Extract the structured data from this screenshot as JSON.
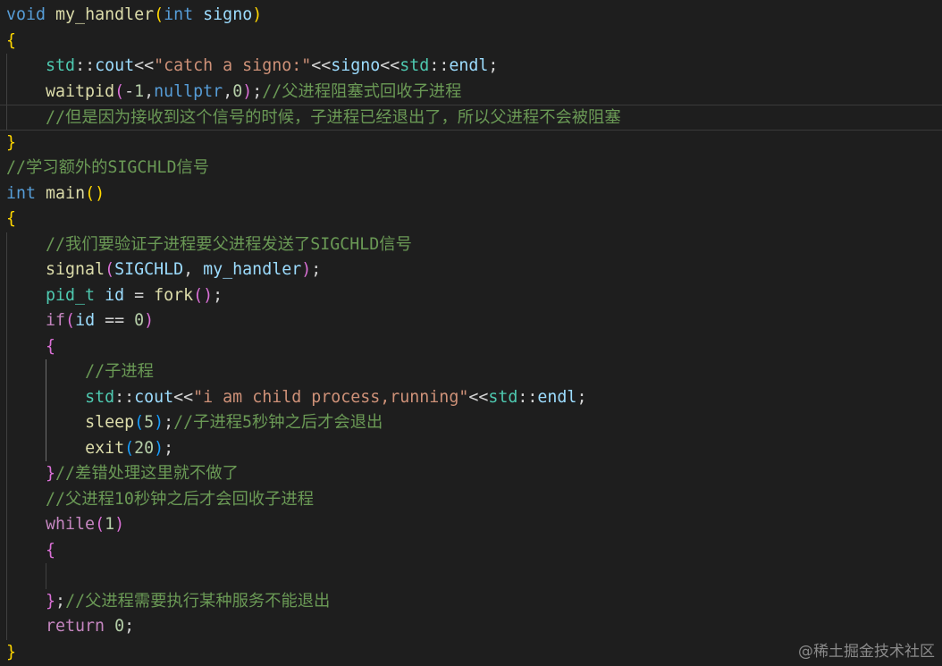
{
  "editor": {
    "theme_colors": {
      "background": "#1e1e1e",
      "keyword": "#569cd6",
      "control": "#c586c0",
      "function": "#dcdcaa",
      "variable": "#9cdcfe",
      "string": "#ce9178",
      "number": "#b5cea8",
      "comment": "#6a9955"
    },
    "lines": [
      [
        [
          "kw",
          "void"
        ],
        [
          "plain",
          " "
        ],
        [
          "fn",
          "my_handler"
        ],
        [
          "br1",
          "("
        ],
        [
          "kw",
          "int"
        ],
        [
          "plain",
          " "
        ],
        [
          "var",
          "signo"
        ],
        [
          "br1",
          ")"
        ]
      ],
      [
        [
          "br1",
          "{"
        ]
      ],
      [
        [
          "plain",
          "    "
        ],
        [
          "ty",
          "std"
        ],
        [
          "plain",
          "::"
        ],
        [
          "var",
          "cout"
        ],
        [
          "plain",
          "<<"
        ],
        [
          "str",
          "\"catch a signo:\""
        ],
        [
          "plain",
          "<<"
        ],
        [
          "var",
          "signo"
        ],
        [
          "plain",
          "<<"
        ],
        [
          "ty",
          "std"
        ],
        [
          "plain",
          "::"
        ],
        [
          "var",
          "endl"
        ],
        [
          "plain",
          ";"
        ]
      ],
      [
        [
          "plain",
          "    "
        ],
        [
          "fn",
          "waitpid"
        ],
        [
          "br2",
          "("
        ],
        [
          "plain",
          "-"
        ],
        [
          "num",
          "1"
        ],
        [
          "plain",
          ","
        ],
        [
          "kw",
          "nullptr"
        ],
        [
          "plain",
          ","
        ],
        [
          "num",
          "0"
        ],
        [
          "br2",
          ")"
        ],
        [
          "plain",
          ";"
        ],
        [
          "cmt",
          "//父进程阻塞式回收子进程"
        ]
      ],
      [
        [
          "plain",
          "    "
        ],
        [
          "cmt",
          "//但是因为接收到这个信号的时候，子进程已经退出了，所以父进程不会被阻塞"
        ]
      ],
      [
        [
          "br1",
          "}"
        ]
      ],
      [
        [
          "cmt",
          "//学习额外的SIGCHLD信号"
        ]
      ],
      [
        [
          "kw",
          "int"
        ],
        [
          "plain",
          " "
        ],
        [
          "fn",
          "main"
        ],
        [
          "br1",
          "()"
        ]
      ],
      [
        [
          "br1",
          "{"
        ]
      ],
      [
        [
          "plain",
          "    "
        ],
        [
          "cmt",
          "//我们要验证子进程要父进程发送了SIGCHLD信号"
        ]
      ],
      [
        [
          "plain",
          "    "
        ],
        [
          "fn",
          "signal"
        ],
        [
          "br2",
          "("
        ],
        [
          "var",
          "SIGCHLD"
        ],
        [
          "plain",
          ", "
        ],
        [
          "var",
          "my_handler"
        ],
        [
          "br2",
          ")"
        ],
        [
          "plain",
          ";"
        ]
      ],
      [
        [
          "plain",
          "    "
        ],
        [
          "ty",
          "pid_t"
        ],
        [
          "plain",
          " "
        ],
        [
          "var",
          "id"
        ],
        [
          "plain",
          " = "
        ],
        [
          "fn",
          "fork"
        ],
        [
          "br2",
          "()"
        ],
        [
          "plain",
          ";"
        ]
      ],
      [
        [
          "plain",
          "    "
        ],
        [
          "ctl",
          "if"
        ],
        [
          "br2",
          "("
        ],
        [
          "var",
          "id"
        ],
        [
          "plain",
          " == "
        ],
        [
          "num",
          "0"
        ],
        [
          "br2",
          ")"
        ]
      ],
      [
        [
          "plain",
          "    "
        ],
        [
          "br2",
          "{"
        ]
      ],
      [
        [
          "plain",
          "        "
        ],
        [
          "cmt",
          "//子进程"
        ]
      ],
      [
        [
          "plain",
          "        "
        ],
        [
          "ty",
          "std"
        ],
        [
          "plain",
          "::"
        ],
        [
          "var",
          "cout"
        ],
        [
          "plain",
          "<<"
        ],
        [
          "str",
          "\"i am child process,running\""
        ],
        [
          "plain",
          "<<"
        ],
        [
          "ty",
          "std"
        ],
        [
          "plain",
          "::"
        ],
        [
          "var",
          "endl"
        ],
        [
          "plain",
          ";"
        ]
      ],
      [
        [
          "plain",
          "        "
        ],
        [
          "fn",
          "sleep"
        ],
        [
          "br3",
          "("
        ],
        [
          "num",
          "5"
        ],
        [
          "br3",
          ")"
        ],
        [
          "plain",
          ";"
        ],
        [
          "cmt",
          "//子进程5秒钟之后才会退出"
        ]
      ],
      [
        [
          "plain",
          "        "
        ],
        [
          "fn",
          "exit"
        ],
        [
          "br3",
          "("
        ],
        [
          "num",
          "20"
        ],
        [
          "br3",
          ")"
        ],
        [
          "plain",
          ";"
        ]
      ],
      [
        [
          "plain",
          "    "
        ],
        [
          "br2",
          "}"
        ],
        [
          "cmt",
          "//差错处理这里就不做了"
        ]
      ],
      [
        [
          "plain",
          "    "
        ],
        [
          "cmt",
          "//父进程10秒钟之后才会回收子进程"
        ]
      ],
      [
        [
          "plain",
          "    "
        ],
        [
          "ctl",
          "while"
        ],
        [
          "br2",
          "("
        ],
        [
          "num",
          "1"
        ],
        [
          "br2",
          ")"
        ]
      ],
      [
        [
          "plain",
          "    "
        ],
        [
          "br2",
          "{"
        ]
      ],
      [
        [
          "plain",
          ""
        ]
      ],
      [
        [
          "plain",
          "    "
        ],
        [
          "br2",
          "}"
        ],
        [
          "plain",
          ";"
        ],
        [
          "cmt",
          "//父进程需要执行某种服务不能退出"
        ]
      ],
      [
        [
          "plain",
          "    "
        ],
        [
          "ctl",
          "return"
        ],
        [
          "plain",
          " "
        ],
        [
          "num",
          "0"
        ],
        [
          "plain",
          ";"
        ]
      ],
      [
        [
          "br1",
          "}"
        ]
      ]
    ],
    "current_line_index": 4
  },
  "watermark": "@稀土掘金技术社区"
}
